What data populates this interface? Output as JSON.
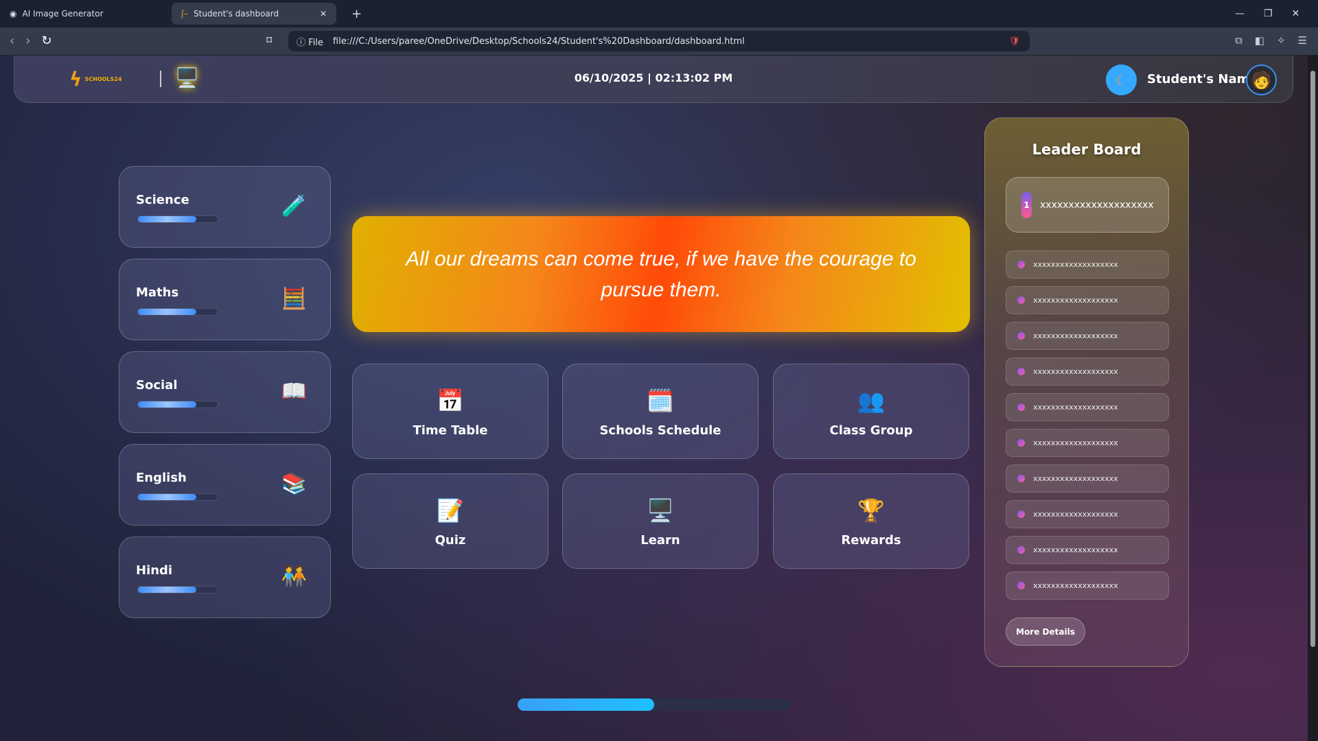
{
  "browser": {
    "tabs": [
      {
        "label": "AI Image Generator",
        "active": false
      },
      {
        "label": "Student's dashboard",
        "active": true
      }
    ],
    "url_scheme": "File",
    "url": "file:///C:/Users/paree/OneDrive/Desktop/Schools24/Student's%20Dashboard/dashboard.html"
  },
  "header": {
    "logo_text": "SCHOOLS24",
    "datetime": "06/10/2025 | 02:13:02 PM",
    "user_name": "Student's Name"
  },
  "subjects": [
    {
      "name": "Science",
      "icon": "🧪",
      "progress": 73
    },
    {
      "name": "Maths",
      "icon": "🧮",
      "progress": 73
    },
    {
      "name": "Social",
      "icon": "📖",
      "progress": 73
    },
    {
      "name": "English",
      "icon": "📚",
      "progress": 73
    },
    {
      "name": "Hindi",
      "icon": "🧑‍🤝‍🧑",
      "progress": 73
    }
  ],
  "quote": "All our dreams can come true, if we have the courage to pursue them.",
  "tiles": [
    {
      "label": "Time Table",
      "icon": "📅"
    },
    {
      "label": "Schools Schedule",
      "icon": "🗓️"
    },
    {
      "label": "Class Group",
      "icon": "👥"
    },
    {
      "label": "Quiz",
      "icon": "📝"
    },
    {
      "label": "Learn",
      "icon": "🖥️"
    },
    {
      "label": "Rewards",
      "icon": "🏆"
    }
  ],
  "leaderboard": {
    "title": "Leader Board",
    "top": {
      "rank": "1",
      "name": "xxxxxxxxxxxxxxxxxxxx"
    },
    "entries": [
      "xxxxxxxxxxxxxxxxxxx",
      "xxxxxxxxxxxxxxxxxxx",
      "xxxxxxxxxxxxxxxxxxx",
      "xxxxxxxxxxxxxxxxxxx",
      "xxxxxxxxxxxxxxxxxxx",
      "xxxxxxxxxxxxxxxxxxx",
      "xxxxxxxxxxxxxxxxxxx",
      "xxxxxxxxxxxxxxxxxxx",
      "xxxxxxxxxxxxxxxxxxx",
      "xxxxxxxxxxxxxxxxxxx"
    ],
    "more_label": "More Details"
  },
  "overall_progress": 50
}
